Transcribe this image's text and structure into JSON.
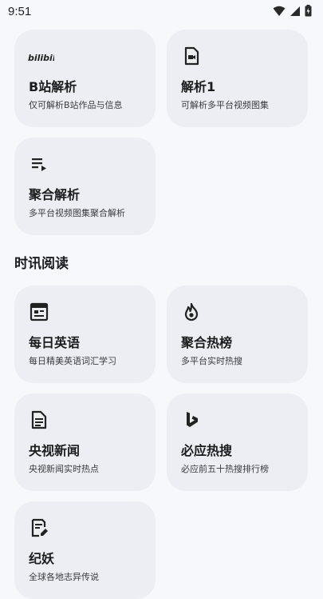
{
  "status_bar": {
    "time": "9:51"
  },
  "parse_cards": [
    {
      "title": "B站解析",
      "subtitle": "仅可解析B站作品与信息",
      "icon": "bilibili-logo-icon"
    },
    {
      "title": "解析1",
      "subtitle": "可解析多平台视频图集",
      "icon": "video-file-icon"
    },
    {
      "title": "聚合解析",
      "subtitle": "多平台视频图集聚合解析",
      "icon": "playlist-icon"
    }
  ],
  "section": {
    "title": "时讯阅读"
  },
  "reading_cards": [
    {
      "title": "每日英语",
      "subtitle": "每日精美英语词汇学习",
      "icon": "calendar-icon"
    },
    {
      "title": "聚合热榜",
      "subtitle": "多平台实时热搜",
      "icon": "fire-icon"
    },
    {
      "title": "央视新闻",
      "subtitle": "央视新闻实时热点",
      "icon": "article-icon"
    },
    {
      "title": "必应热搜",
      "subtitle": "必应前五十热搜排行榜",
      "icon": "bing-icon"
    },
    {
      "title": "纪妖",
      "subtitle": "全球各地志异传说",
      "icon": "edit-note-icon"
    }
  ],
  "bilibili_logo_text": "bilibili"
}
